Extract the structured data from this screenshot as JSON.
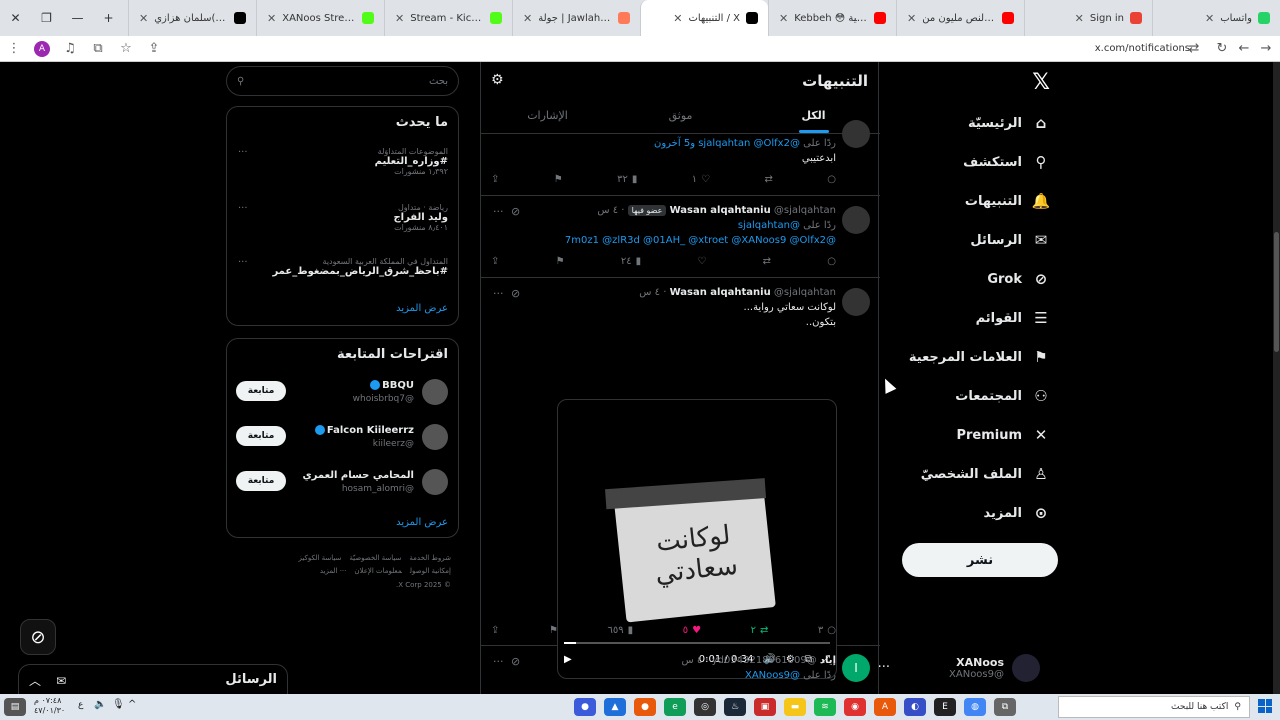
{
  "browser": {
    "tabs": [
      {
        "title": "واتساب",
        "color": "#25d366",
        "active": false
      },
      {
        "title": "Sign in",
        "color": "#ea4335",
        "active": false
      },
      {
        "title": "تحدي النص مليون من",
        "color": "#ff0000",
        "active": false
      },
      {
        "title": "Kebbeh 😳 بالصينية",
        "color": "#ff0000",
        "active": false
      },
      {
        "title": "التنبيهات / X",
        "color": "#000000",
        "active": true
      },
      {
        "title": "جولة | Jawlah - منصة",
        "color": "#ff7a59",
        "active": false
      },
      {
        "title": "Stream - Kick Dashb",
        "color": "#53fc18",
        "active": false
      },
      {
        "title": "XANoos Stream - Wa",
        "color": "#53fc18",
        "active": false
      },
      {
        "title": "سلمان هزازي(@_j7zu",
        "color": "#010101",
        "active": false
      }
    ],
    "url": "x.com/notifications",
    "avatar_letter": "A"
  },
  "nav": {
    "items": [
      {
        "label": "الرئيسيّة",
        "icon": "home-icon",
        "glyph": "⌂"
      },
      {
        "label": "استكشف",
        "icon": "search-icon",
        "glyph": "⚲"
      },
      {
        "label": "التنبيهات",
        "icon": "bell-icon",
        "glyph": "🔔"
      },
      {
        "label": "الرسائل",
        "icon": "mail-icon",
        "glyph": "✉"
      },
      {
        "label": "Grok",
        "icon": "grok-icon",
        "glyph": "⊘"
      },
      {
        "label": "القوائم",
        "icon": "list-icon",
        "glyph": "☰"
      },
      {
        "label": "العلامات المرجعية",
        "icon": "bookmark-icon",
        "glyph": "⚑"
      },
      {
        "label": "المجتمعات",
        "icon": "communities-icon",
        "glyph": "⚇"
      },
      {
        "label": "Premium",
        "icon": "x-logo-icon",
        "glyph": "✕"
      },
      {
        "label": "الملف الشخصيّ",
        "icon": "profile-icon",
        "glyph": "♙"
      },
      {
        "label": "المزيد",
        "icon": "more-icon",
        "glyph": "⊙"
      }
    ],
    "post_label": "نشر",
    "profile_name": "XANoos",
    "profile_handle": "@XANoos9"
  },
  "center": {
    "title": "التنبيهات",
    "tabs": [
      "الكل",
      "موثق",
      "الإشارات"
    ],
    "tweet1": {
      "line1_prefix": "ردًا على",
      "line1_mentions": "@sjalqahtan @Olfx2",
      "line1_others": "و5 آخرون",
      "text": "ابدعتيبي",
      "views": "٣٢",
      "likes": "١"
    },
    "tweet2": {
      "name": "Wasan alqahtaniu",
      "handle": "@sjalqahtan",
      "time": "· ٤ س",
      "badge": "عضو فيها",
      "reply_prefix": "ردًا على",
      "reply_to": "@sjalqahtan",
      "mentions": "@7m0z1 @zlR3d @01AH_ @xtroet @XANoos9 @Olfx2",
      "views": "٢٤"
    },
    "tweet3": {
      "name": "Wasan alqahtaniu",
      "handle": "@sjalqahtan",
      "time": "· ٤ س",
      "line1": "لوكانت سعاتي رواية...",
      "line2": "بتكون..",
      "card_text": "لوكانت سعادتي",
      "video_time": "0:01 / 0:34",
      "views": "٦٥٩",
      "likes": "٥",
      "reposts": "٢",
      "replies": "٣"
    },
    "tweet4": {
      "name": "إياد",
      "handle": "@yd0343218961009",
      "time": "· ٤ س",
      "reply_prefix": "ردًا على",
      "reply_to": "@XANoos9",
      "avatar_letter": "I"
    }
  },
  "side": {
    "search_placeholder": "بحث",
    "trending_title": "ما يحدث",
    "trends": [
      {
        "category": "الموضوعات المتداوَلة",
        "name": "#وزاره_التعليم",
        "count": "١٫٣٩٢ منشورات"
      },
      {
        "category": "رياضة · متداول",
        "name": "وليد الفراج",
        "count": "٨٫٤٠١ منشورات"
      },
      {
        "category": "المتداول في المملكة العربية السعودية",
        "name": "#باحظ_شرق_الرياض_بمضغوط_عمر",
        "count": ""
      }
    ],
    "show_more": "عرض المزيد",
    "follow_title": "اقتراحات المتابعة",
    "follows": [
      {
        "name": "BBQU",
        "handle": "@whoisbrbq7",
        "button": "متابعة"
      },
      {
        "name": "Falcon Kiileerrz",
        "handle": "@kiileerz",
        "button": "متابعة"
      },
      {
        "name": "المحامي حسام العمري",
        "handle": "@hosam_alomri",
        "button": "متابعة"
      }
    ],
    "follow_more": "عرض المزيد",
    "footer": [
      "شروط الخدمة",
      "سياسة الخصوصيّة",
      "سياسة الكوكيز",
      "إمكانية الوصول",
      "معلومات الإعلان",
      "··· المزيد",
      "© 2025 X Corp."
    ]
  },
  "messages_bar": {
    "title": "الرسائل"
  },
  "taskbar": {
    "search_placeholder": "اكتب هنا للبحث",
    "time": "٠٧:٤٨ م",
    "date": "٤٧/٠١/٣٠",
    "lang": "ع"
  }
}
